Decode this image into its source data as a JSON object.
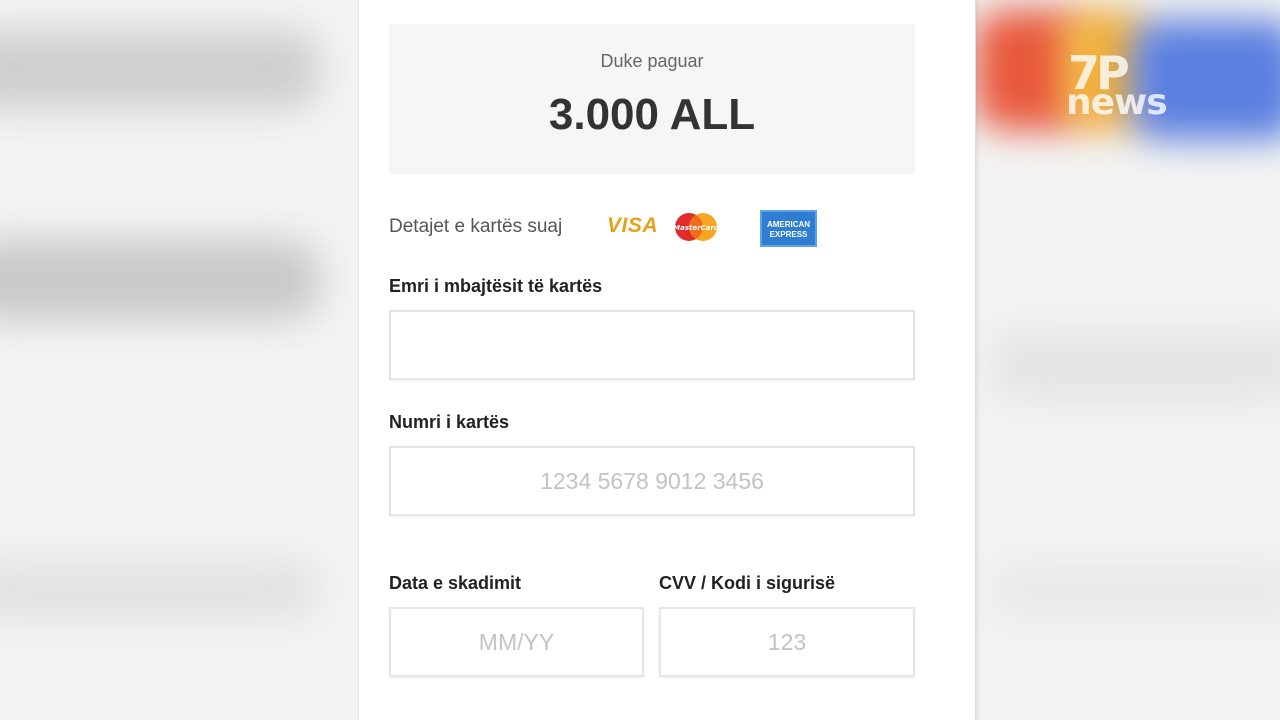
{
  "watermark": {
    "number": "7P",
    "word": "news"
  },
  "payment": {
    "paying_label": "Duke paguar",
    "amount": "3.000 ALL",
    "card_details_label": "Detajet e kartës suaj",
    "brands": {
      "visa": "VISA",
      "mastercard": "MasterCard",
      "amex_line1": "AMERICAN",
      "amex_line2": "EXPRESS"
    }
  },
  "form": {
    "cardholder_label": "Emri i mbajtësit të kartës",
    "cardholder_value": "",
    "card_number_label": "Numri i kartës",
    "card_number_placeholder": "1234 5678 9012 3456",
    "expiry_label": "Data e skadimit",
    "expiry_placeholder": "MM/YY",
    "cvv_label": "CVV / Kodi i sigurisë",
    "cvv_placeholder": "123"
  }
}
